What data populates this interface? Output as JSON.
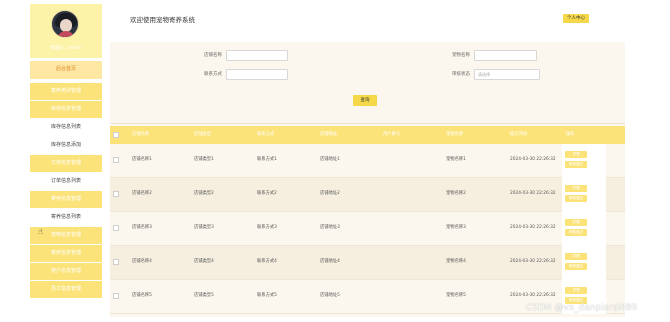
{
  "header": {
    "title": "欢迎使用宠物寄养系统",
    "user_center": "个人中心"
  },
  "sidebar": {
    "username": "管理员：admin",
    "menu": [
      {
        "label": "后台首页",
        "type": "home"
      },
      {
        "label": "寄养类别管理",
        "type": "group"
      },
      {
        "label": "库存信息管理",
        "type": "group"
      },
      {
        "label": "库存信息列表",
        "type": "sub"
      },
      {
        "label": "库存信息添加",
        "type": "sub"
      },
      {
        "label": "订单信息管理",
        "type": "group"
      },
      {
        "label": "订单信息列表",
        "type": "sub"
      },
      {
        "label": "寄养信息管理",
        "type": "group"
      },
      {
        "label": "寄养信息列表",
        "type": "sub"
      },
      {
        "label": "宠物信息管理",
        "type": "group"
      },
      {
        "label": "寄养信息管理",
        "type": "group"
      },
      {
        "label": "用户信息管理",
        "type": "group"
      },
      {
        "label": "员工信息管理",
        "type": "group"
      }
    ]
  },
  "search": {
    "labels": [
      "店铺名称",
      "宠物名称",
      "联系方式",
      "审核状态"
    ],
    "values": [
      "",
      "",
      "",
      ""
    ],
    "status_placeholder": "请选择",
    "button": "查询"
  },
  "table": {
    "headers": [
      "店铺名称",
      "店铺类型",
      "联系方式",
      "店铺地址",
      "用户账号",
      "宠物名称",
      "提交时间",
      "操作"
    ],
    "rows": [
      [
        "店铺名称1",
        "店铺类型1",
        "联系方式1",
        "店铺地址1",
        "",
        "宠物名称1",
        "2024-03-30 22:26:32"
      ],
      [
        "店铺名称2",
        "店铺类型2",
        "联系方式2",
        "店铺地址2",
        "",
        "宠物名称2",
        "2024-03-30 22:26:32"
      ],
      [
        "店铺名称3",
        "店铺类型3",
        "联系方式3",
        "店铺地址3",
        "",
        "宠物名称3",
        "2024-03-30 22:26:32"
      ],
      [
        "店铺名称4",
        "店铺类型4",
        "联系方式4",
        "店铺地址4",
        "",
        "宠物名称4",
        "2024-03-30 22:26:32"
      ],
      [
        "店铺名称5",
        "店铺类型5",
        "联系方式5",
        "店铺地址5",
        "",
        "宠物名称5",
        "2024-03-30 22:26:32"
      ]
    ],
    "actions": [
      "详情",
      "审核通过"
    ]
  },
  "watermark": "CSDN @vx_danpianji889",
  "colors": {
    "accent": "#fbe37a",
    "profile_bg": "#fcf2a8",
    "button": "#f5d84a",
    "panel_bg": "#fbf7ee"
  }
}
